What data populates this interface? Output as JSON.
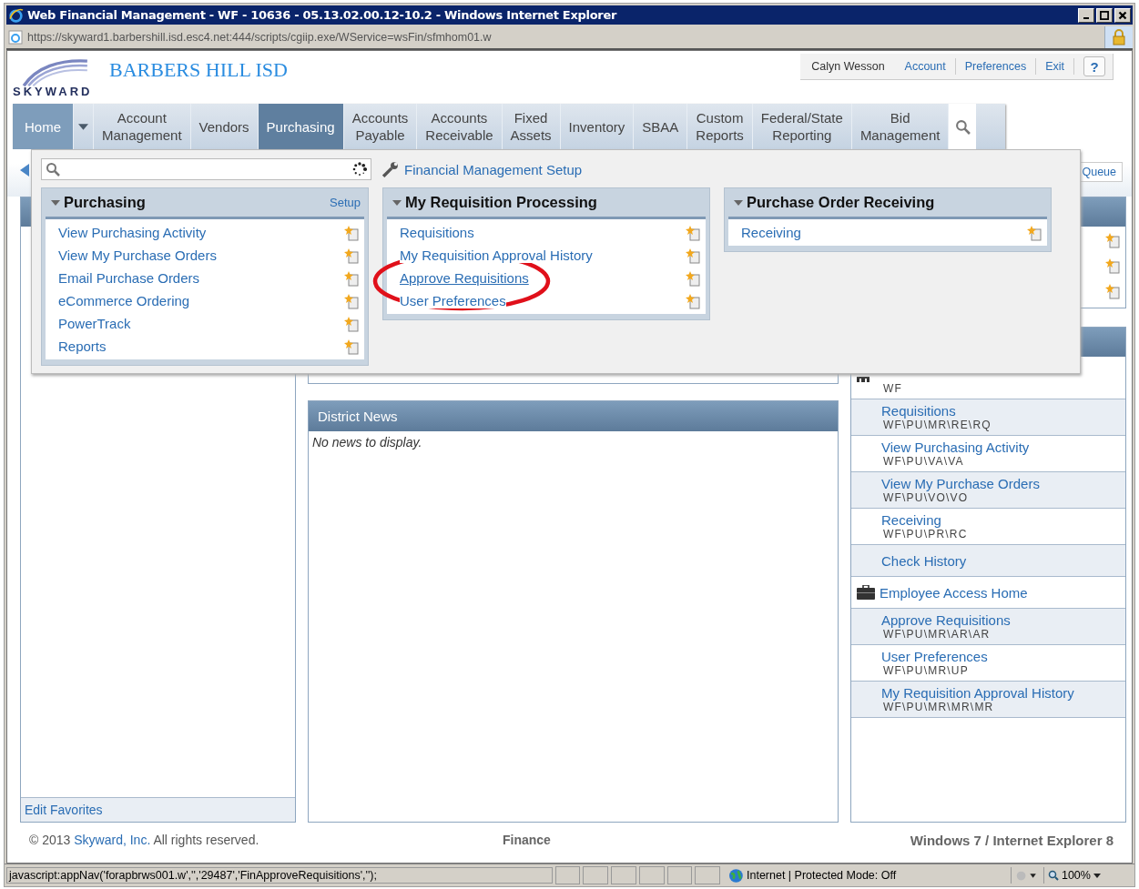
{
  "window": {
    "title": "Web Financial Management - WF - 10636 - 05.13.02.00.12-10.2 - Windows Internet Explorer"
  },
  "address_bar": {
    "url": "https://skyward1.barbershill.isd.esc4.net:444/scripts/cgiip.exe/WService=wsFin/sfmhom01.w"
  },
  "header": {
    "logo_text": "SKYWARD",
    "district": "BARBERS HILL ISD",
    "user_links": [
      {
        "label": "Calyn Wesson",
        "kind": "name"
      },
      {
        "label": "Account",
        "kind": "link"
      },
      {
        "label": "Preferences",
        "kind": "link"
      },
      {
        "label": "Exit",
        "kind": "link"
      },
      {
        "label": "?",
        "kind": "help"
      }
    ]
  },
  "nav": [
    {
      "label": "Home",
      "selected": false,
      "current": true,
      "dropdown": true
    },
    {
      "label": "Account Management",
      "selected": false,
      "current": false,
      "dropdown": false
    },
    {
      "label": "Vendors",
      "selected": false,
      "current": false,
      "dropdown": false
    },
    {
      "label": "Purchasing",
      "selected": true,
      "current": false,
      "dropdown": false
    },
    {
      "label": "Accounts Payable",
      "selected": false,
      "current": false,
      "dropdown": false
    },
    {
      "label": "Accounts Receivable",
      "selected": false,
      "current": false,
      "dropdown": false
    },
    {
      "label": "Fixed Assets",
      "selected": false,
      "current": false,
      "dropdown": false
    },
    {
      "label": "Inventory",
      "selected": false,
      "current": false,
      "dropdown": false
    },
    {
      "label": "SBAA",
      "selected": false,
      "current": false,
      "dropdown": false
    },
    {
      "label": "Custom Reports",
      "selected": false,
      "current": false,
      "dropdown": false
    },
    {
      "label": "Federal/State Reporting",
      "selected": false,
      "current": false,
      "dropdown": false
    },
    {
      "label": "Bid Management",
      "selected": false,
      "current": false,
      "dropdown": false
    }
  ],
  "menu": {
    "setup_link": "Financial Management Setup",
    "groups": [
      {
        "title": "Purchasing",
        "setup": "Setup",
        "items": [
          {
            "label": "View Purchasing Activity",
            "hovered": false
          },
          {
            "label": "View My Purchase Orders",
            "hovered": false
          },
          {
            "label": "Email Purchase Orders",
            "hovered": false
          },
          {
            "label": "eCommerce Ordering",
            "hovered": false
          },
          {
            "label": "PowerTrack",
            "hovered": false
          },
          {
            "label": "Reports",
            "hovered": false
          }
        ]
      },
      {
        "title": "My Requisition Processing",
        "items": [
          {
            "label": "Requisitions",
            "hovered": false
          },
          {
            "label": "My Requisition Approval History",
            "hovered": false
          },
          {
            "label": "Approve Requisitions",
            "hovered": true
          },
          {
            "label": "User Preferences",
            "hovered": false
          }
        ]
      },
      {
        "title": "Purchase Order Receiving",
        "items": [
          {
            "label": "Receiving",
            "hovered": false
          }
        ]
      }
    ]
  },
  "queue_button": "Queue",
  "favorites": {
    "edit_link": "Edit Favorites"
  },
  "district_news": {
    "title": "District News",
    "empty_text": "No news to display."
  },
  "recent_items": [
    {
      "kind": "partial",
      "code": "WF"
    },
    {
      "kind": "link",
      "title": "Requisitions",
      "code": "WF\\PU\\MR\\RE\\RQ"
    },
    {
      "kind": "link",
      "title": "View Purchasing Activity",
      "code": "WF\\PU\\VA\\VA"
    },
    {
      "kind": "link",
      "title": "View My Purchase Orders",
      "code": "WF\\PU\\VO\\VO"
    },
    {
      "kind": "link",
      "title": "Receiving",
      "code": "WF\\PU\\PR\\RC"
    },
    {
      "kind": "link",
      "title": "Check History"
    },
    {
      "kind": "section",
      "title": "Employee Access Home"
    },
    {
      "kind": "link",
      "title": "Approve Requisitions",
      "code": "WF\\PU\\MR\\AR\\AR"
    },
    {
      "kind": "link",
      "title": "User Preferences",
      "code": "WF\\PU\\MR\\UP"
    },
    {
      "kind": "link",
      "title": "My Requisition Approval History",
      "code": "WF\\PU\\MR\\MR\\MR"
    }
  ],
  "footer": {
    "copyright_pre": "© 2013",
    "company": "Skyward, Inc.",
    "copyright_post": "All rights reserved.",
    "module": "Finance",
    "platform": "Windows 7 / Internet Explorer 8"
  },
  "status_bar": {
    "text": "javascript:appNav('forapbrws001.w','','29487','FinApproveRequisitions','');",
    "zone": "Internet | Protected Mode: Off",
    "zoom": "100%"
  }
}
